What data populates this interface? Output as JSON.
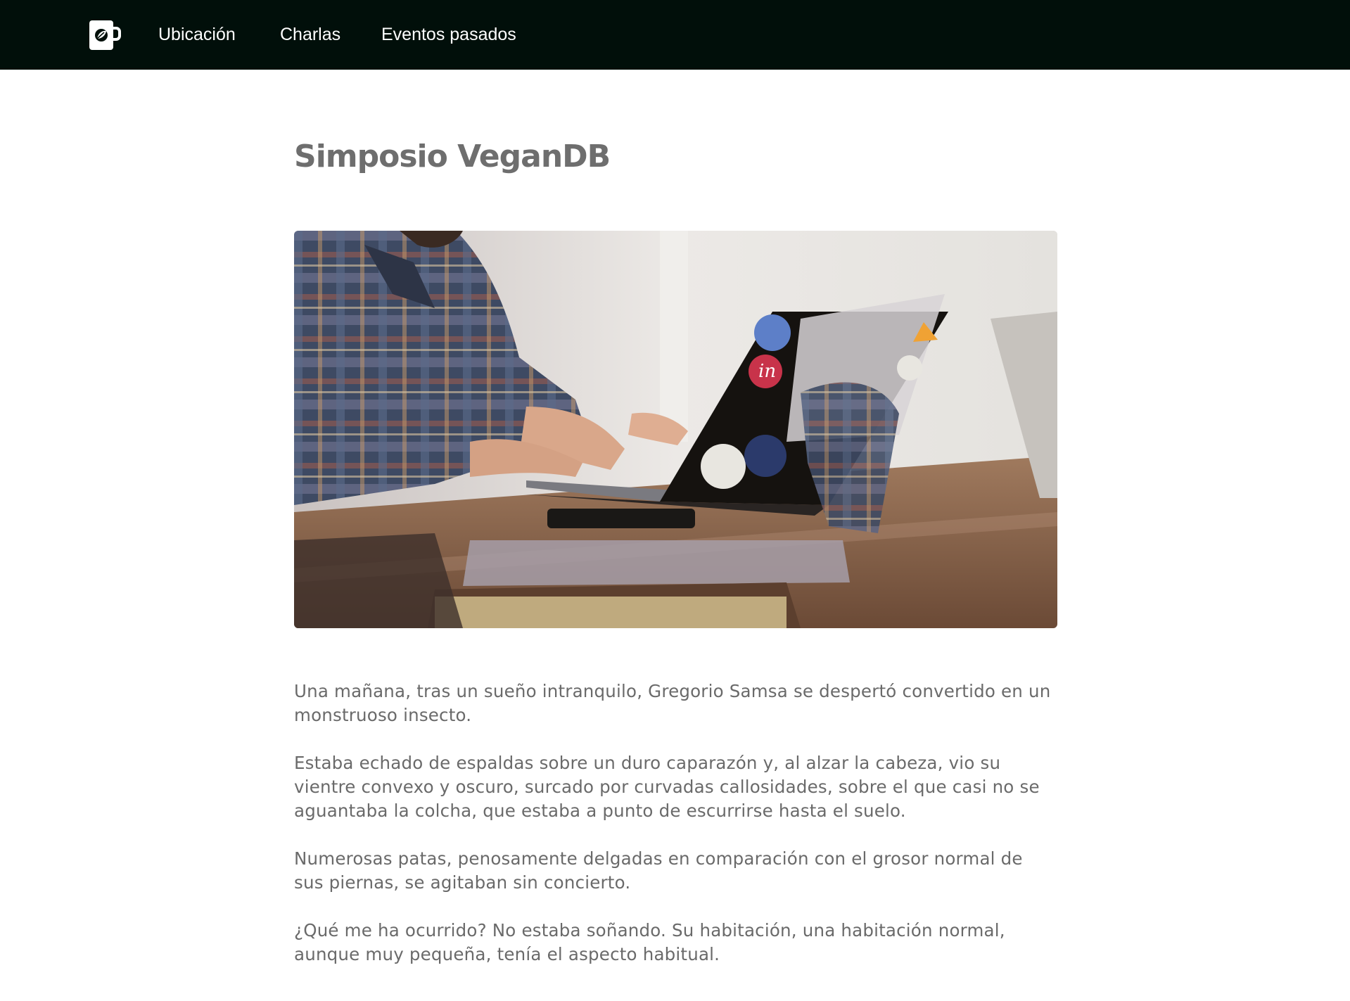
{
  "nav": {
    "links": [
      {
        "label": "Ubicación"
      },
      {
        "label": "Charlas"
      },
      {
        "label": "Eventos pasados"
      }
    ]
  },
  "page": {
    "title": "Simposio VeganDB",
    "paragraphs": [
      "Una mañana, tras un sueño intranquilo, Gregorio Samsa se despertó convertido en un monstruoso insecto.",
      "Estaba echado de espaldas sobre un duro caparazón y, al alzar la cabeza, vio su vientre convexo y oscuro, surcado por curvadas callosidades, sobre el que casi no se aguantaba la colcha, que estaba a punto de escurrirse hasta el suelo.",
      "Numerosas patas, penosamente delgadas en comparación con el grosor normal de sus piernas, se agitaban sin concierto.",
      "¿Qué me ha ocurrido? No estaba soñando. Su habitación, una habitación normal, aunque muy pequeña, tenía el aspecto habitual."
    ]
  },
  "colors": {
    "topbar": "#010f0a",
    "title": "#6e6e6e",
    "body_text": "#6a6a6a"
  },
  "icons": {
    "logo": "mug-leaf-icon"
  }
}
